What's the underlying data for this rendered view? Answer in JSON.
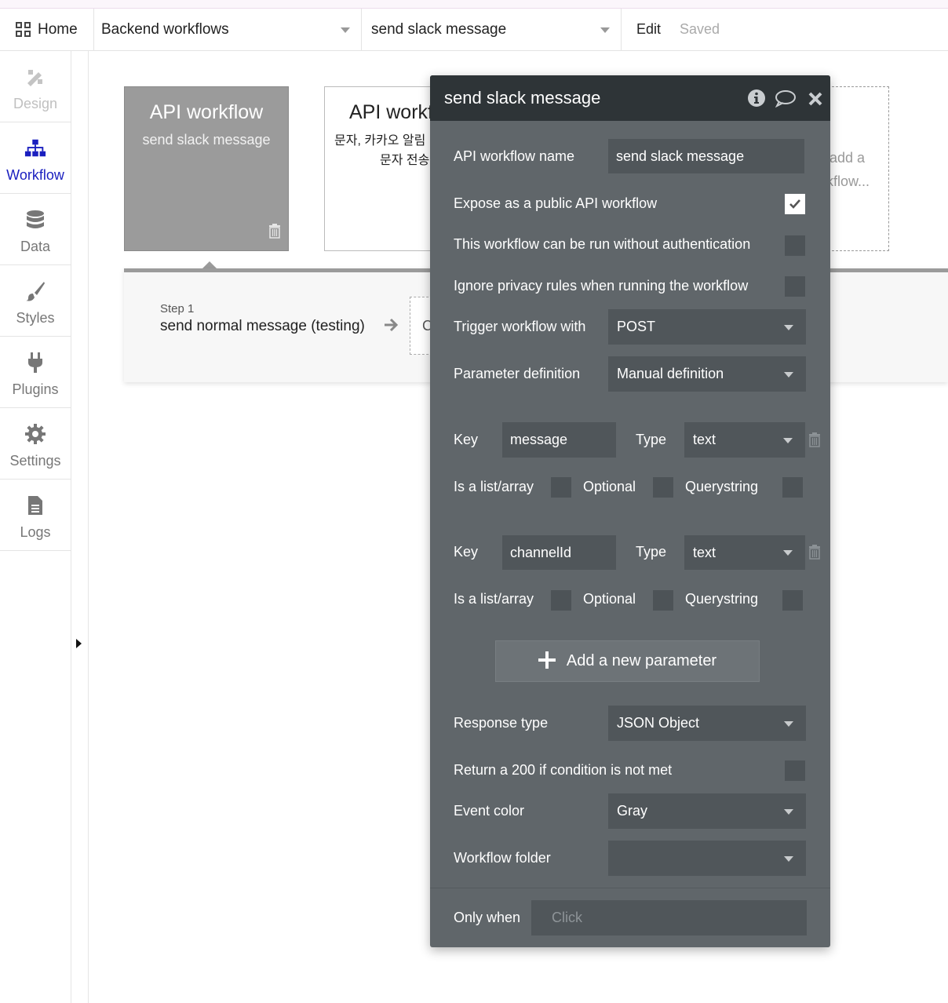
{
  "topbar": {
    "home_label": "Home",
    "page_selector": "Backend workflows",
    "workflow_selector": "send slack message",
    "edit_label": "Edit",
    "save_status": "Saved"
  },
  "sidebar": {
    "items": [
      {
        "label": "Design",
        "icon": "design-icon",
        "state": "disabled"
      },
      {
        "label": "Workflow",
        "icon": "workflow-icon",
        "state": "active"
      },
      {
        "label": "Data",
        "icon": "database-icon",
        "state": "normal"
      },
      {
        "label": "Styles",
        "icon": "brush-icon",
        "state": "normal"
      },
      {
        "label": "Plugins",
        "icon": "plug-icon",
        "state": "normal"
      },
      {
        "label": "Settings",
        "icon": "gear-icon",
        "state": "normal"
      },
      {
        "label": "Logs",
        "icon": "document-icon",
        "state": "normal"
      }
    ]
  },
  "canvas": {
    "card1": {
      "title": "API workflow",
      "subtitle": "send slack message"
    },
    "card2": {
      "title": "API workf",
      "line1": "문자, 카카오 알림",
      "line2": "문자 전송"
    },
    "card3": {
      "line1": "add a",
      "line2": "kflow..."
    },
    "step": {
      "label": "Step 1",
      "name": "send normal message (testing)",
      "next": "C"
    }
  },
  "panel": {
    "title": "send slack message",
    "name_label": "API workflow name",
    "name_value": "send slack message",
    "expose_label": "Expose as a public API workflow",
    "expose_checked": true,
    "no_auth_label": "This workflow can be run without authentication",
    "ignore_privacy_label": "Ignore privacy rules when running the workflow",
    "trigger_label": "Trigger workflow with",
    "trigger_value": "POST",
    "param_def_label": "Parameter definition",
    "param_def_value": "Manual definition",
    "params": [
      {
        "key_label": "Key",
        "key": "message",
        "type_label": "Type",
        "type": "text",
        "list_label": "Is a list/array",
        "optional_label": "Optional",
        "query_label": "Querystring"
      },
      {
        "key_label": "Key",
        "key": "channelId",
        "type_label": "Type",
        "type": "text",
        "list_label": "Is a list/array",
        "optional_label": "Optional",
        "query_label": "Querystring"
      }
    ],
    "add_param_label": "Add a new parameter",
    "response_label": "Response type",
    "response_value": "JSON Object",
    "return200_label": "Return a 200 if condition is not met",
    "event_color_label": "Event color",
    "event_color_value": "Gray",
    "folder_label": "Workflow folder",
    "folder_value": "",
    "only_when_label": "Only when",
    "only_when_placeholder": "Click"
  }
}
